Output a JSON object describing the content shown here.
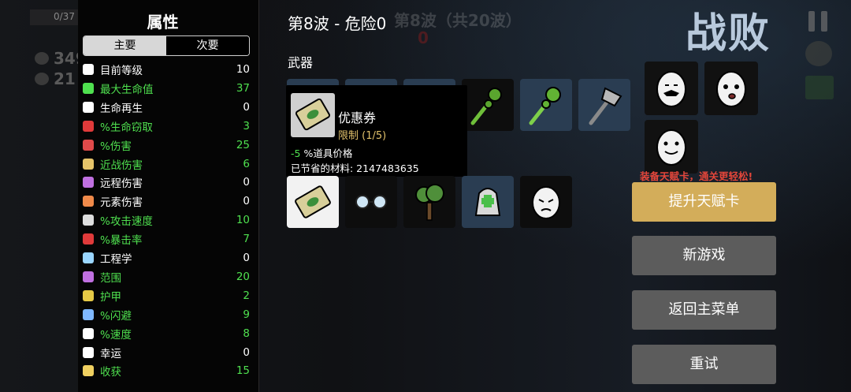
{
  "background": {
    "hud_hp": "0/37",
    "hud_materials": "349",
    "hud_bag": "21",
    "wave_bg_text": "第8波（共20波）",
    "wave_bg_timer": "0"
  },
  "stats_panel": {
    "title": "属性",
    "tabs": [
      {
        "label": "主要",
        "active": true
      },
      {
        "label": "次要",
        "active": false
      }
    ],
    "rows": [
      {
        "icon": "level-icon",
        "label": "目前等级",
        "value": "10",
        "green": false
      },
      {
        "icon": "heart-icon",
        "label": "最大生命值",
        "value": "37",
        "green": true
      },
      {
        "icon": "regen-icon",
        "label": "生命再生",
        "value": "0",
        "green": false
      },
      {
        "icon": "lifesteal-icon",
        "label": "%生命窃取",
        "value": "3",
        "green": true
      },
      {
        "icon": "damage-icon",
        "label": "%伤害",
        "value": "25",
        "green": true
      },
      {
        "icon": "melee-icon",
        "label": "近战伤害",
        "value": "6",
        "green": true
      },
      {
        "icon": "ranged-icon",
        "label": "远程伤害",
        "value": "0",
        "green": false
      },
      {
        "icon": "elemental-icon",
        "label": "元素伤害",
        "value": "0",
        "green": false
      },
      {
        "icon": "attack-speed-icon",
        "label": "%攻击速度",
        "value": "10",
        "green": true
      },
      {
        "icon": "crit-icon",
        "label": "%暴击率",
        "value": "7",
        "green": true
      },
      {
        "icon": "engineering-icon",
        "label": "工程学",
        "value": "0",
        "green": false
      },
      {
        "icon": "range-icon",
        "label": "范围",
        "value": "20",
        "green": true
      },
      {
        "icon": "armor-icon",
        "label": "护甲",
        "value": "2",
        "green": true
      },
      {
        "icon": "dodge-icon",
        "label": "%闪避",
        "value": "9",
        "green": true
      },
      {
        "icon": "speed-icon",
        "label": "%速度",
        "value": "8",
        "green": true
      },
      {
        "icon": "luck-icon",
        "label": "幸运",
        "value": "0",
        "green": false
      },
      {
        "icon": "harvest-icon",
        "label": "收获",
        "value": "15",
        "green": true
      }
    ]
  },
  "header": {
    "wave_title": "第8波 - 危险0",
    "result": "战败"
  },
  "weapons": {
    "label": "武器"
  },
  "tooltip": {
    "name": "优惠券",
    "limit": "限制 (1/5)",
    "effect_value": "-5",
    "effect_text": " %道具价格",
    "saved": "已节省的材料: 2147483635"
  },
  "side": {
    "promo": "装备天赋卡，通关更轻松!",
    "upgrade_button": "提升天赋卡",
    "new_game_button": "新游戏",
    "main_menu_button": "返回主菜单",
    "retry_button": "重试"
  },
  "colors": {
    "stat_green": "#4fe04f",
    "gold_button": "#d3ad5a",
    "gray_button": "#5c5c5c",
    "promo_red": "#e3463a",
    "defeat_text": "#b8c9dc"
  }
}
